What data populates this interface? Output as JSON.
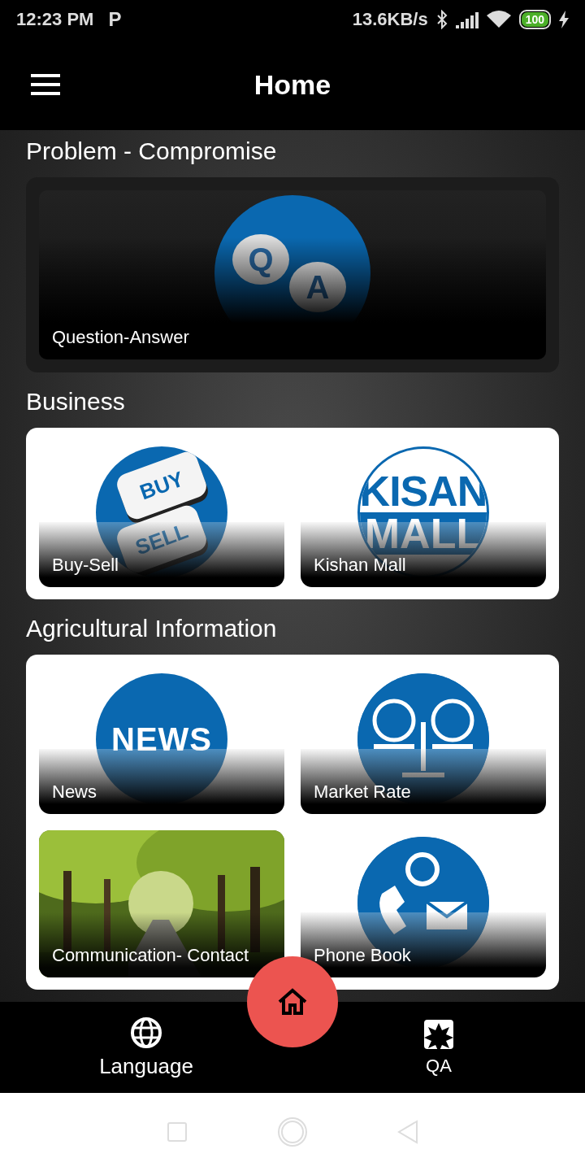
{
  "status_bar": {
    "time": "12:23 PM",
    "app_badge": "P",
    "net_speed": "13.6KB/s",
    "battery": "100"
  },
  "app_bar": {
    "title": "Home"
  },
  "sections": [
    {
      "title": "Problem - Compromise",
      "tiles": [
        {
          "label": "Question-Answer",
          "kind": "qa",
          "logo_text": [
            "Q",
            "A"
          ]
        }
      ]
    },
    {
      "title": "Business",
      "tiles": [
        {
          "label": "Buy-Sell",
          "kind": "buysell",
          "logo_text": [
            "BUY",
            "SELL"
          ]
        },
        {
          "label": "Kishan Mall",
          "kind": "mall",
          "logo_text": [
            "KISAN",
            "MALL"
          ]
        }
      ]
    },
    {
      "title": "Agricultural Information",
      "tiles": [
        {
          "label": "News",
          "kind": "news",
          "logo_text": [
            "NEWS"
          ]
        },
        {
          "label": "Market Rate",
          "kind": "market"
        },
        {
          "label": "Communication- Contact",
          "kind": "picture"
        },
        {
          "label": "Phone Book",
          "kind": "phone"
        }
      ]
    }
  ],
  "bottom_nav": [
    {
      "label": "Language",
      "kind": "language"
    },
    {
      "label": "QA",
      "kind": "qa"
    }
  ]
}
